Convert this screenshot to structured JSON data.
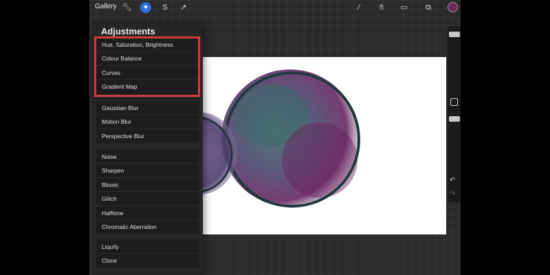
{
  "topbar": {
    "gallery_label": "Gallery",
    "left_tools": [
      "wrench-icon",
      "magic-wand-icon",
      "selection-icon",
      "transform-icon"
    ],
    "right_tools": [
      "brush-icon",
      "smudge-icon",
      "eraser-icon",
      "layers-icon"
    ],
    "current_color": "#6a2a5a"
  },
  "adjustments": {
    "title": "Adjustments",
    "groups": [
      [
        "Hue, Saturation, Brightness",
        "Colour Balance",
        "Curves",
        "Gradient Map"
      ],
      [
        "Gaussian Blur",
        "Motion Blur",
        "Perspective Blur"
      ],
      [
        "Noise",
        "Sharpen",
        "Bloom",
        "Glitch",
        "Halftone",
        "Chromatic Aberration"
      ],
      [
        "Liquify",
        "Clone"
      ]
    ]
  },
  "highlight_color": "#d43a3a",
  "accent_color": "#2f6fd8"
}
